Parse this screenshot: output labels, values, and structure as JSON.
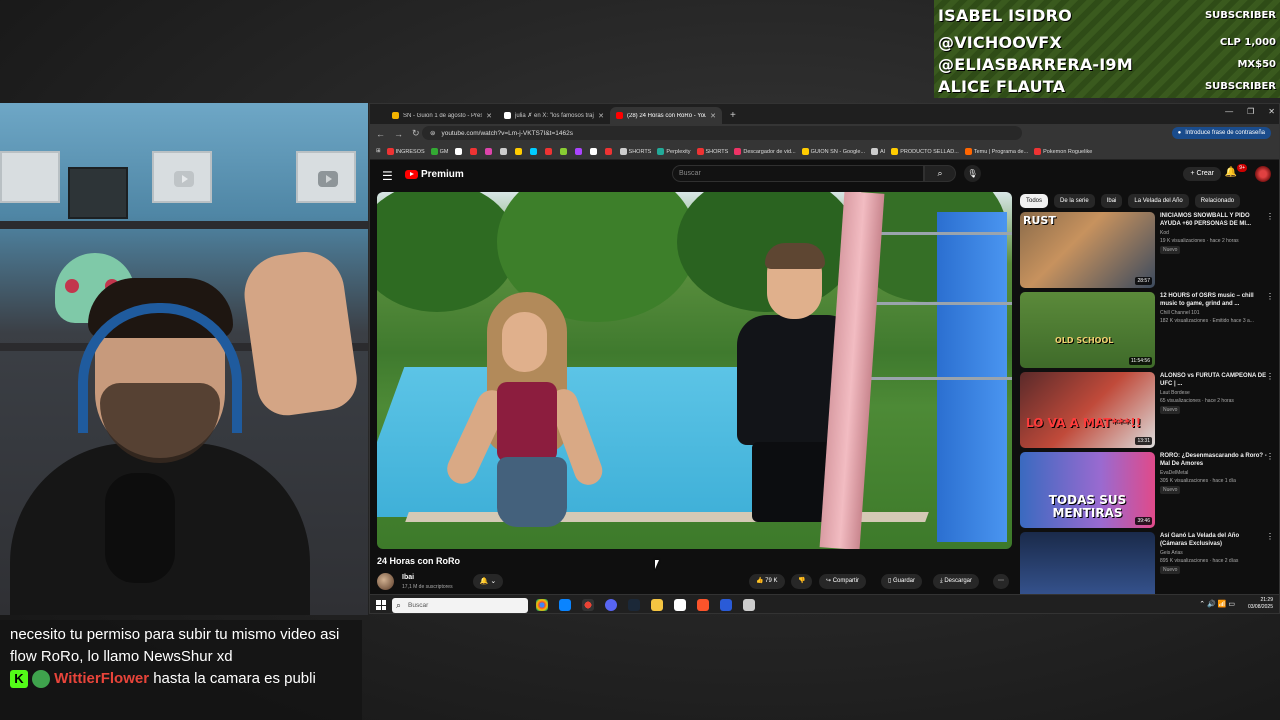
{
  "alerts": [
    {
      "name": "ISABEL ISIDRO",
      "tag": "SUBSCRIBER"
    },
    {
      "name": "@VICHOOVFX",
      "tag": "CLP 1,000"
    },
    {
      "name": "@ELIASBARRERA-I9M",
      "tag": "MX$50"
    },
    {
      "name": "ALICE FLAUTA",
      "tag": "SUBSCRIBER"
    }
  ],
  "chat": {
    "message1": "necesito tu permiso para subir tu mismo video asi flow RoRo, lo llamo NewsShur xd",
    "badge_k": "K",
    "user": "WittierFlower",
    "message2": "hasta la camara es publi"
  },
  "browser": {
    "tabs": [
      {
        "label": "SN - Guion 1 de agosto - Prese",
        "color": "#f4b400",
        "active": false
      },
      {
        "label": "julia ✗ en X: \"los famosos traje",
        "color": "#ffffff",
        "active": false
      },
      {
        "label": "(28) 24 Horas con RoRo - YouT",
        "color": "#ff0000",
        "active": true
      }
    ],
    "new_tab": "+",
    "url": "youtube.com/watch?v=Lm-j-VKTS7I&t=1462s",
    "password_prompt": "Introduce frase de contraseña",
    "bookmarks": [
      "INGRESOS",
      "GM",
      "SHORTS",
      "Perplexity",
      "SHORTS",
      "Descargador de vid...",
      "GUION SN - Google...",
      "AI",
      "PRODUCTO SELLAD...",
      "Temu | Programa de...",
      "Pokemon Roguelike"
    ]
  },
  "youtube": {
    "logo_text": "Premium",
    "search_placeholder": "Buscar",
    "create_label": "+ Crear",
    "notif_count": "9+",
    "video_title": "24 Horas con RoRo",
    "channel_name": "Ibai",
    "channel_subs": "17,1 M de suscriptores",
    "likes": "79 K",
    "share_label": "Compartir",
    "save_label": "Guardar",
    "download_label": "Descargar",
    "chips": [
      "Todos",
      "De la serie",
      "Ibai",
      "La Velada del Año",
      "Relacionado"
    ],
    "recommendations": [
      {
        "title": "INICIAMOS SNOWBALL Y PIDO AYUDA +60 PERSONAS DE MI...",
        "channel": "Kod",
        "meta": "19 K visualizaciones · hace 2 horas",
        "badge": "Nuevo",
        "duration": "28:57",
        "thumb_text": "RUST"
      },
      {
        "title": "12 HOURS of OSRS music – chill music to game, grind and ...",
        "channel": "Chill Channel 101",
        "meta": "182 K visualizaciones · Emitido hace 3 a...",
        "badge": "",
        "duration": "11:54:56",
        "thumb_text": "OLD SCHOOL"
      },
      {
        "title": "ALONSO vs FURUTA CAMPEONA DE UFC | ...",
        "channel": "Laut Bordese",
        "meta": "65 visualizaciones · hace 2 horas",
        "badge": "Nuevo",
        "duration": "13:31",
        "thumb_text": "LO VA A MAT***!!"
      },
      {
        "title": "RORO: ¿Desenmascarando a Roro? - Mal De Amores",
        "channel": "EvaDelMetal",
        "meta": "305 K visualizaciones · hace 1 día",
        "badge": "Nuevo",
        "duration": "39:46",
        "thumb_text": "TODAS SUS MENTIRAS"
      },
      {
        "title": "Así Ganó La Velada del Año (Cámaras Exclusivas)",
        "channel": "Geis Arias",
        "meta": "895 K visualizaciones · hace 2 días",
        "badge": "Nuevo",
        "duration": "",
        "thumb_text": ""
      }
    ]
  },
  "taskbar": {
    "search_placeholder": "Buscar",
    "time": "21:29",
    "date": "03/08/2025"
  }
}
